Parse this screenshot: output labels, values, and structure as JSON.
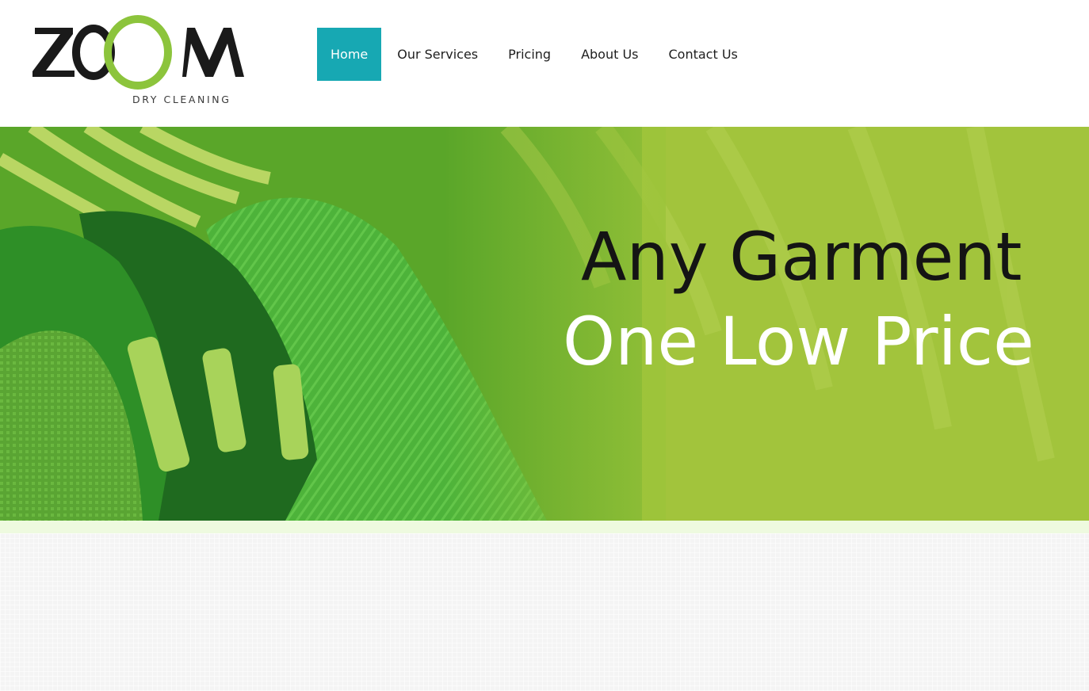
{
  "brand": {
    "logo_word": "ZOOM",
    "logo_tagline": "DRY CLEANING",
    "colors": {
      "ring": "#8cc43c",
      "text": "#1a1a1a"
    }
  },
  "nav": {
    "items": [
      {
        "label": "Home",
        "active": true
      },
      {
        "label": "Our Services",
        "active": false
      },
      {
        "label": "Pricing",
        "active": false
      },
      {
        "label": "About Us",
        "active": false
      },
      {
        "label": "Contact Us",
        "active": false
      }
    ],
    "active_color": "#17a8b3"
  },
  "hero": {
    "line1": "Any Garment",
    "line2": "One Low Price",
    "background_color": "#8fc33a"
  }
}
